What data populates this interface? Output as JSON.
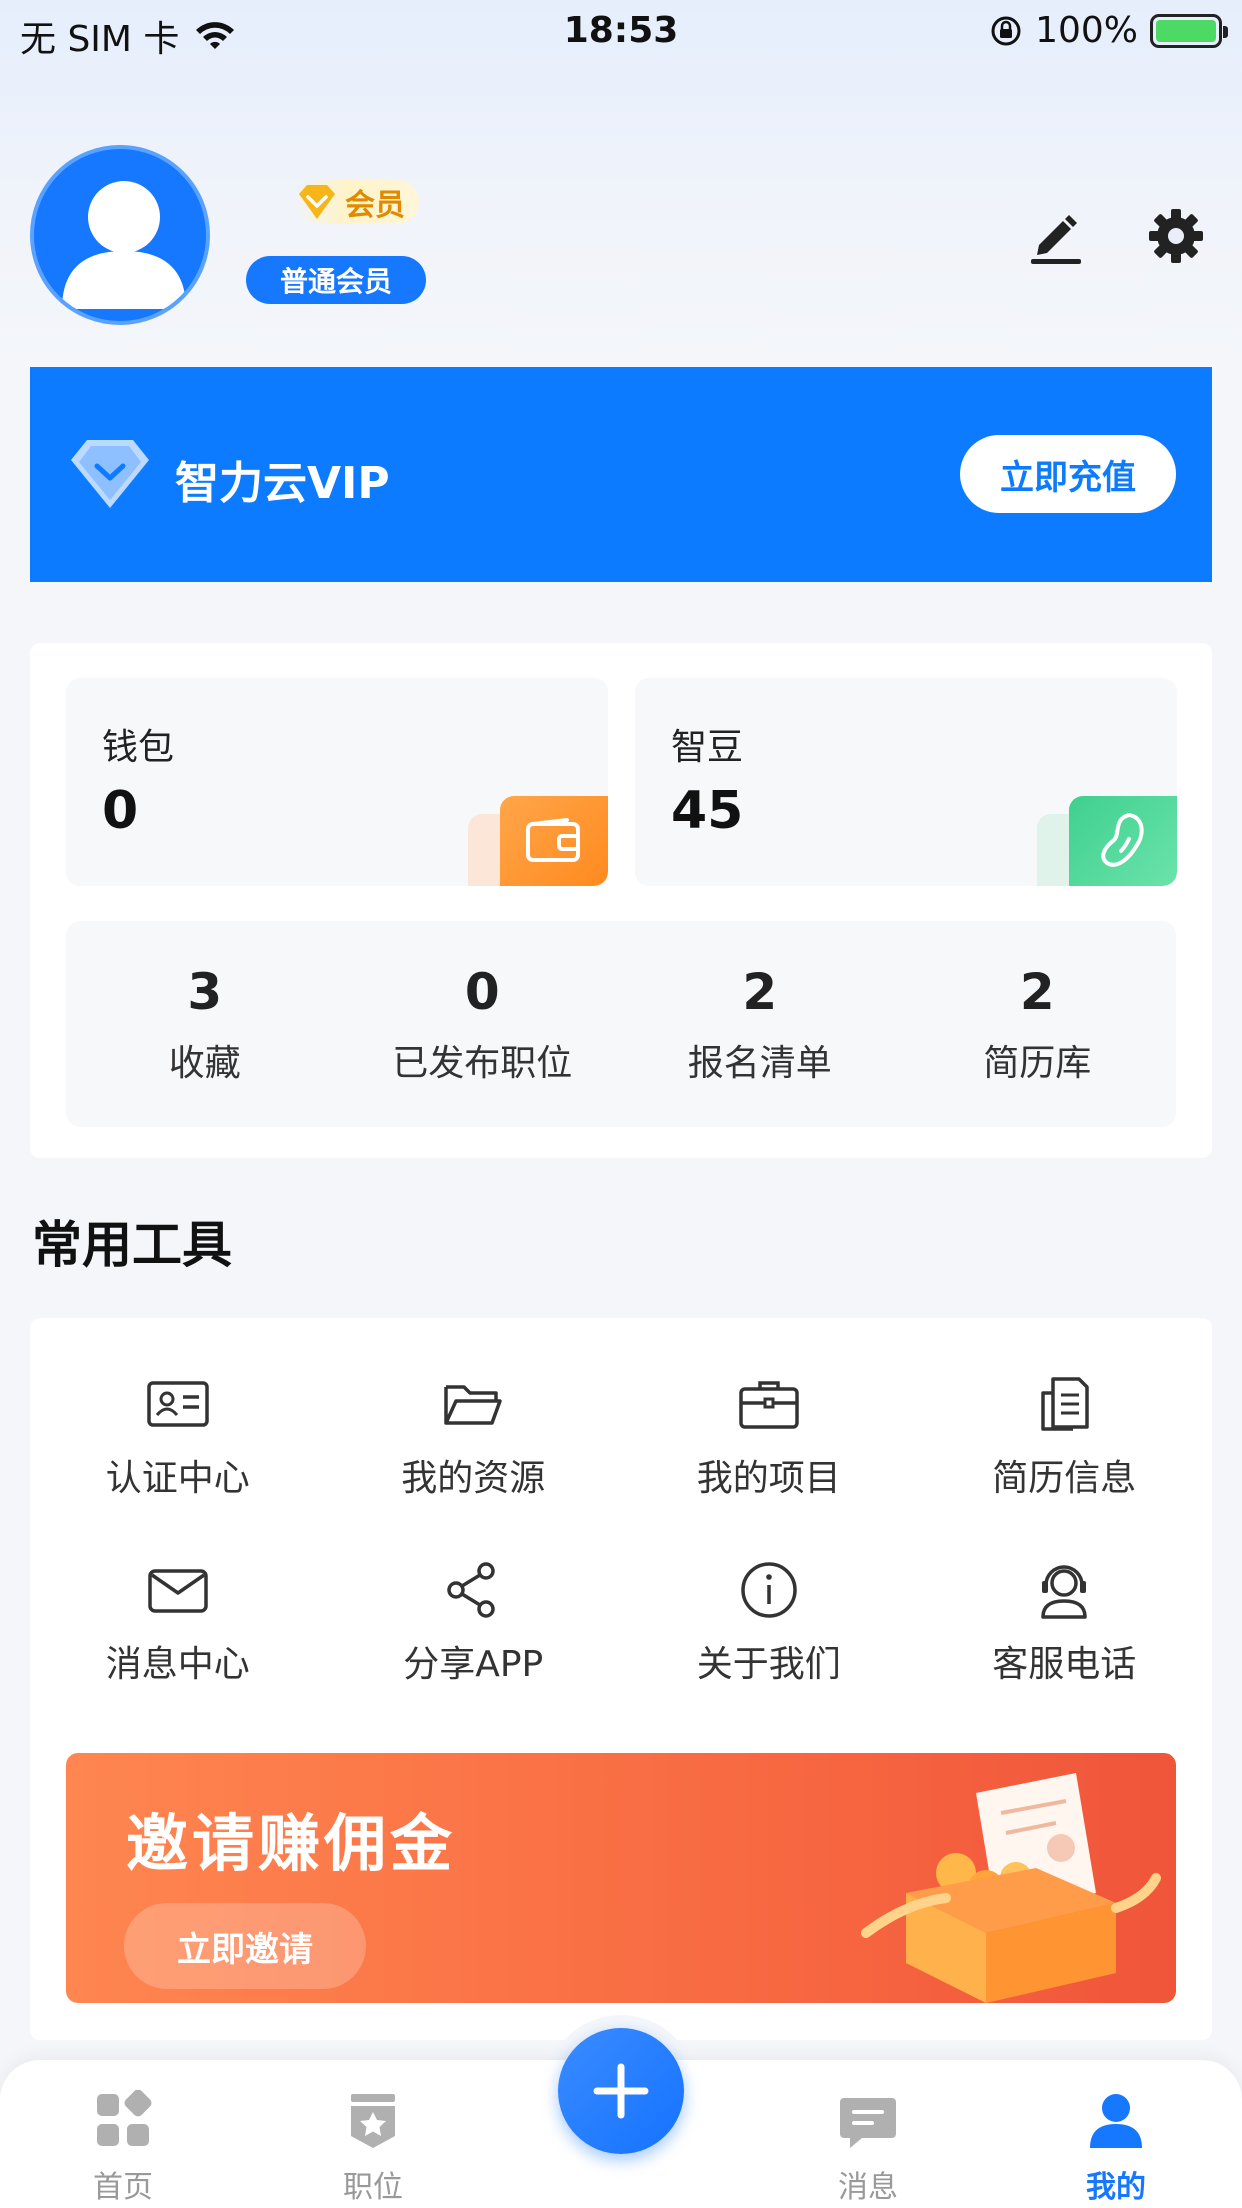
{
  "status_bar": {
    "carrier": "无 SIM 卡",
    "time": "18:53",
    "battery": "100%"
  },
  "profile": {
    "member_tag": "会员",
    "level": "普通会员"
  },
  "vip": {
    "title": "智力云VIP",
    "button": "立即充值"
  },
  "assets": {
    "wallet": {
      "label": "钱包",
      "value": "0"
    },
    "beans": {
      "label": "智豆",
      "value": "45"
    }
  },
  "stats": [
    {
      "value": "3",
      "label": "收藏"
    },
    {
      "value": "0",
      "label": "已发布职位"
    },
    {
      "value": "2",
      "label": "报名清单"
    },
    {
      "value": "2",
      "label": "简历库"
    }
  ],
  "tools_section": {
    "title": "常用工具",
    "items": [
      {
        "label": "认证中心",
        "icon": "id-card-icon"
      },
      {
        "label": "我的资源",
        "icon": "folder-icon"
      },
      {
        "label": "我的项目",
        "icon": "briefcase-icon"
      },
      {
        "label": "简历信息",
        "icon": "document-icon"
      },
      {
        "label": "消息中心",
        "icon": "mail-icon"
      },
      {
        "label": "分享APP",
        "icon": "share-icon"
      },
      {
        "label": "关于我们",
        "icon": "info-icon"
      },
      {
        "label": "客服电话",
        "icon": "headset-icon"
      }
    ]
  },
  "invite": {
    "title": "邀请赚佣金",
    "button": "立即邀请"
  },
  "tabbar": {
    "items": [
      {
        "label": "首页",
        "icon": "home-grid-icon",
        "active": false
      },
      {
        "label": "职位",
        "icon": "badge-icon",
        "active": false
      },
      {
        "label": "消息",
        "icon": "chat-icon",
        "active": false
      },
      {
        "label": "我的",
        "icon": "user-icon",
        "active": true
      }
    ]
  },
  "colors": {
    "primary": "#1677ff",
    "vip_banner": "#0d7bff",
    "invite_orange": "#f86a42",
    "wallet_orange": "#ff8a1f",
    "bean_green": "#3fd08e"
  }
}
